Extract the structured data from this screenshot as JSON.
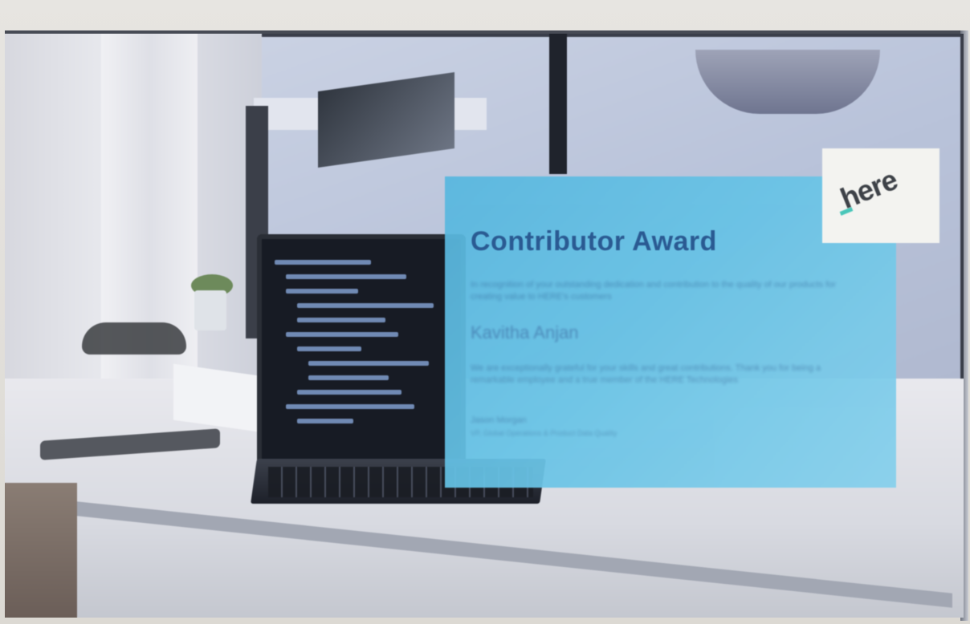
{
  "award_card": {
    "title": "Contributor Award",
    "intro": "In recognition of your outstanding dedication and contribution to the quality of our products for creating value to HERE's customers",
    "recipient": "Kavitha Anjan",
    "body": "We are exceptionally grateful for your skills and great contributions. Thank you for being a remarkable employee and a true member of the HERE Technologies",
    "signer_name": "Jason Morgan",
    "signer_title": "VP, Global Operations & Product Data Quality"
  },
  "logo": {
    "text": "here",
    "accent_color": "#48c6b9"
  },
  "colors": {
    "card": "#67c3e6",
    "title": "#20538d",
    "screen_bg": "#b9c3da"
  }
}
